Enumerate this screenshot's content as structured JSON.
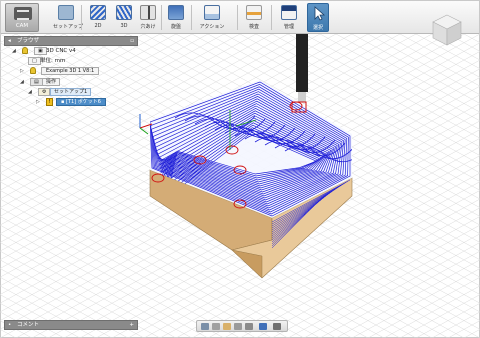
{
  "toolbar": {
    "workspace_label": "CAM",
    "tools": [
      {
        "label": "セットアップ",
        "icon": "setup-icon"
      },
      {
        "label": "2D",
        "icon": "2d-icon"
      },
      {
        "label": "3D",
        "icon": "3d-icon"
      },
      {
        "label": "穴あけ",
        "icon": "drilling-icon"
      },
      {
        "label": "旋盤",
        "icon": "turning-icon"
      },
      {
        "label": "アクション",
        "icon": "actions-icon"
      },
      {
        "label": "検査",
        "icon": "inspect-icon"
      },
      {
        "label": "管理",
        "icon": "manage-icon"
      },
      {
        "label": "選択",
        "icon": "select-icon"
      }
    ]
  },
  "browser": {
    "title": "ブラウザ",
    "items": [
      {
        "label": "3D CNC v4"
      },
      {
        "label": "単位: mm"
      },
      {
        "label": "Example 3D 1 V8:1"
      },
      {
        "label": "操作"
      },
      {
        "label": "セットアップ1"
      },
      {
        "label": "[T1] ポケット6"
      }
    ]
  },
  "comment_bar": {
    "label": "コメント"
  },
  "colors": {
    "toolpath": "#2020d8",
    "stock": "#e9c99a",
    "stock_side": "#d4ac76",
    "tool": "#222222",
    "rapid": "#d01010",
    "accent": "#3d78ad"
  }
}
